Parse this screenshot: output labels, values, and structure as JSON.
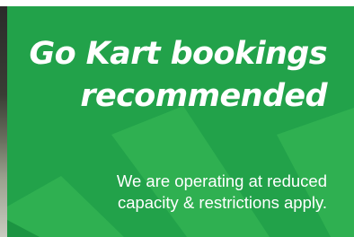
{
  "banner": {
    "headline_line1": "Go Kart bookings",
    "headline_line2": "recommended",
    "subtext_line1": "We are operating at reduced",
    "subtext_line2": "capacity & restrictions apply.",
    "colors": {
      "background": "#22a24a",
      "shape_light": "#2fb051",
      "shape_dark": "#1c9442",
      "text": "#ffffff"
    }
  }
}
